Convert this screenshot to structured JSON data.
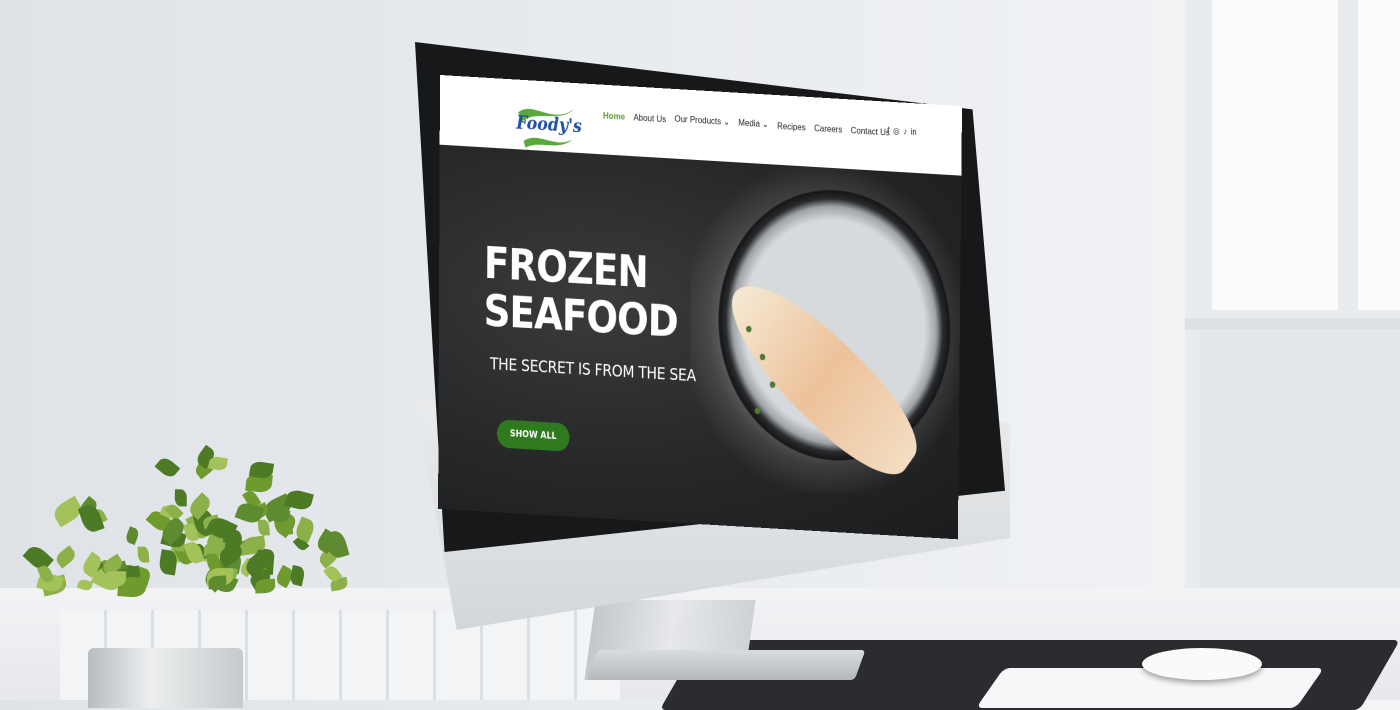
{
  "site": {
    "logo_text": "Foody's",
    "nav": [
      {
        "label": "Home",
        "active": true
      },
      {
        "label": "About Us"
      },
      {
        "label": "Our Products",
        "has_dropdown": true
      },
      {
        "label": "Media",
        "has_dropdown": true
      },
      {
        "label": "Recipes"
      },
      {
        "label": "Careers"
      },
      {
        "label": "Contact Us"
      }
    ],
    "social": [
      {
        "icon": "facebook-icon",
        "glyph": "f"
      },
      {
        "icon": "instagram-icon",
        "glyph": "◎"
      },
      {
        "icon": "tiktok-icon",
        "glyph": "♪"
      },
      {
        "icon": "linkedin-icon",
        "glyph": "in"
      }
    ],
    "hero": {
      "title": "FROZEN SEAFOOD",
      "subtitle": "THE SECRET IS FROM THE SEA",
      "button_label": "SHOW ALL"
    },
    "colors": {
      "accent_green": "#2f7a1f",
      "active_nav": "#5a9a36",
      "logo_blue": "#1f4fa2"
    }
  }
}
